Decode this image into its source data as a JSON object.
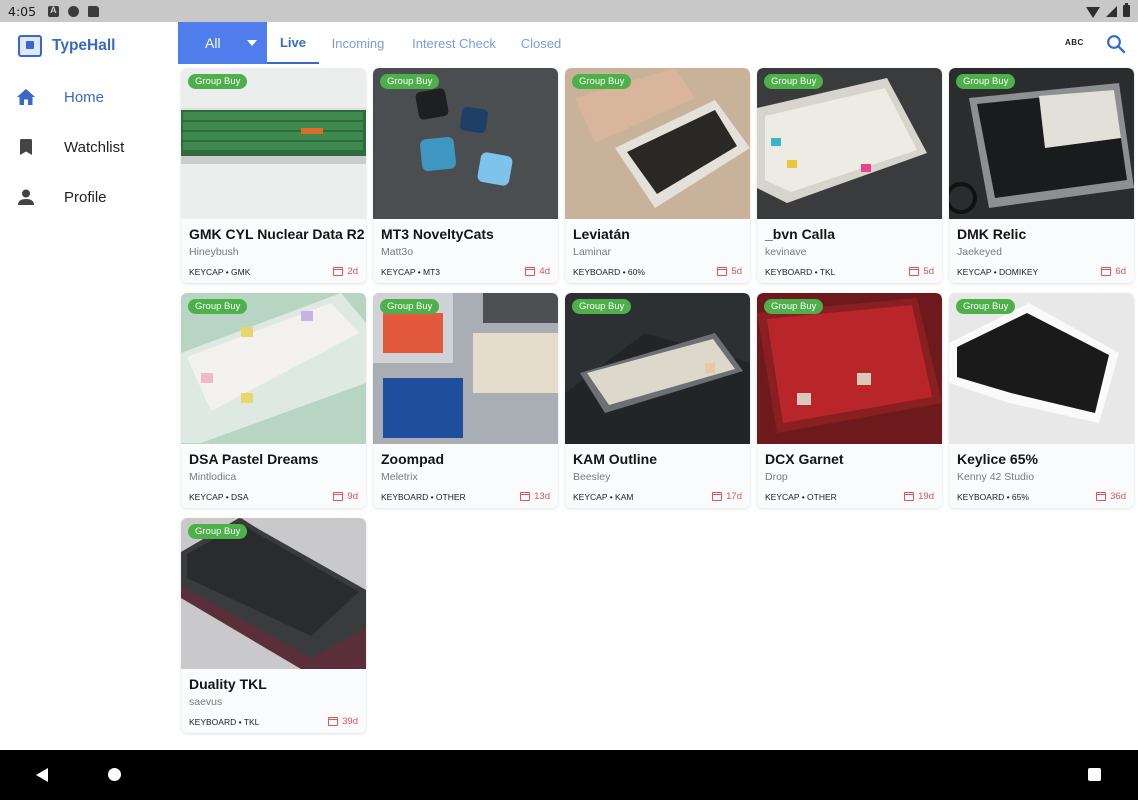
{
  "status_bar": {
    "time": "4:05"
  },
  "app": {
    "name": "TypeHall",
    "brand_color": "#3a68c9",
    "accent": "#4f7dec"
  },
  "sidebar": {
    "items": [
      {
        "label": "Home",
        "icon": "home-icon",
        "active": true
      },
      {
        "label": "Watchlist",
        "icon": "bookmark-icon",
        "active": false
      },
      {
        "label": "Profile",
        "icon": "person-icon",
        "active": false
      }
    ]
  },
  "filter": {
    "selected": "All"
  },
  "tabs": [
    {
      "label": "Live",
      "active": true
    },
    {
      "label": "Incoming",
      "active": false
    },
    {
      "label": "Interest Check",
      "active": false
    },
    {
      "label": "Closed",
      "active": false
    }
  ],
  "toolbar": {
    "sort_label": "ABC"
  },
  "products": [
    {
      "badge": "Group Buy",
      "title": "GMK CYL Nuclear Data R2",
      "author": "Hineybush",
      "tags": "KEYCAP • GMK",
      "days": "2d"
    },
    {
      "badge": "Group Buy",
      "title": "MT3 NoveltyCats",
      "author": "Matt3o",
      "tags": "KEYCAP • MT3",
      "days": "4d"
    },
    {
      "badge": "Group Buy",
      "title": "Leviatán",
      "author": "Laminar",
      "tags": "KEYBOARD • 60%",
      "days": "5d"
    },
    {
      "badge": "Group Buy",
      "title": "_bvn Calla",
      "author": "kevinave",
      "tags": "KEYBOARD • TKL",
      "days": "5d"
    },
    {
      "badge": "Group Buy",
      "title": "DMK Relic",
      "author": "Jaekeyed",
      "tags": "KEYCAP • DOMIKEY",
      "days": "6d"
    },
    {
      "badge": "Group Buy",
      "title": "DSA Pastel Dreams",
      "author": "Mintlodica",
      "tags": "KEYCAP • DSA",
      "days": "9d"
    },
    {
      "badge": "Group Buy",
      "title": "Zoompad",
      "author": "Meletrix",
      "tags": "KEYBOARD • OTHER",
      "days": "13d"
    },
    {
      "badge": "Group Buy",
      "title": "KAM Outline",
      "author": "Beesley",
      "tags": "KEYCAP • KAM",
      "days": "17d"
    },
    {
      "badge": "Group Buy",
      "title": "DCX Garnet",
      "author": "Drop",
      "tags": "KEYCAP • OTHER",
      "days": "19d"
    },
    {
      "badge": "Group Buy",
      "title": "Keylice 65%",
      "author": "Kenny 42 Studio",
      "tags": "KEYBOARD • 65%",
      "days": "36d"
    },
    {
      "badge": "Group Buy",
      "title": "Duality TKL",
      "author": "saevus",
      "tags": "KEYBOARD • TKL",
      "days": "39d"
    }
  ]
}
